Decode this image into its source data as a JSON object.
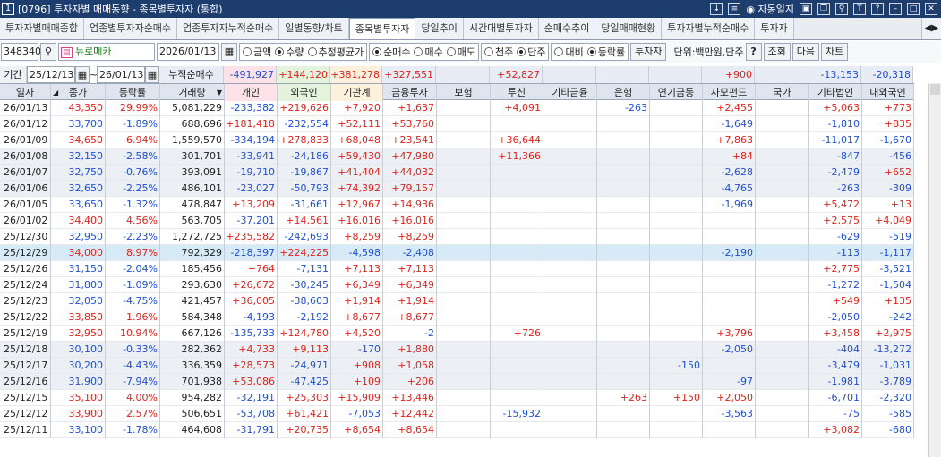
{
  "title": {
    "num": "1",
    "text": "[0796] 투자자별 매매동향 - 종목별투자자 (통합)",
    "autolog": "자동일지"
  },
  "tabs": [
    "투자자별매매종합",
    "업종별투자자순매수",
    "업종투자자누적순매수",
    "일별동향/차트",
    "종목별투자자",
    "당일추이",
    "시간대별투자자",
    "순매수추이",
    "당일매매현황",
    "투자자별누적순매수",
    "투자자"
  ],
  "active_tab": 4,
  "controls": {
    "code": "348340",
    "stock_name": "뉴로메카",
    "date": "2026/01/13",
    "amount_label": "금액",
    "qty_label": "수량",
    "est_label": "추정평균가",
    "net_label": "순매수",
    "buy_label": "매수",
    "sell_label": "매도",
    "thousand_label": "천주",
    "share_label": "단주",
    "compare_label": "대비",
    "rate_label": "등락률",
    "investor_btn": "투자자",
    "unit_label": "단위:백만원,단주",
    "help": "?",
    "search_btn": "조회",
    "next_btn": "다음",
    "chart_btn": "차트"
  },
  "summary": {
    "period_label": "기간",
    "from": "25/12/13",
    "to": "26/01/13",
    "cum_label": "누적순매수",
    "values": [
      "-491,927",
      "+144,120",
      "+381,278",
      "+327,551",
      "",
      "+52,827",
      "",
      "",
      "",
      "+900",
      "",
      "-13,153",
      "-20,318"
    ]
  },
  "headers": [
    "일자",
    "종가",
    "등락률",
    "거래량",
    "개인",
    "외국인",
    "기관계",
    "금융투자",
    "보험",
    "투신",
    "기타금융",
    "은행",
    "연기금등",
    "사모펀드",
    "국가",
    "기타법인",
    "내외국인"
  ],
  "rows": [
    [
      "26/01/13",
      "43,350",
      "29.99%",
      "5,081,229",
      "-233,382",
      "+219,626",
      "+7,920",
      "+1,637",
      "",
      "+4,091",
      "",
      "-263",
      "",
      "+2,455",
      "",
      "+5,063",
      "+773"
    ],
    [
      "26/01/12",
      "33,700",
      "-1.89%",
      "688,696",
      "+181,418",
      "-232,554",
      "+52,111",
      "+53,760",
      "",
      "",
      "",
      "",
      "",
      "-1,649",
      "",
      "-1,810",
      "+835"
    ],
    [
      "26/01/09",
      "34,650",
      "6.94%",
      "1,559,570",
      "-334,194",
      "+278,833",
      "+68,048",
      "+23,541",
      "",
      "+36,644",
      "",
      "",
      "",
      "+7,863",
      "",
      "-11,017",
      "-1,670"
    ],
    [
      "26/01/08",
      "32,150",
      "-2.58%",
      "301,701",
      "-33,941",
      "-24,186",
      "+59,430",
      "+47,980",
      "",
      "+11,366",
      "",
      "",
      "",
      "+84",
      "",
      "-847",
      "-456"
    ],
    [
      "26/01/07",
      "32,750",
      "-0.76%",
      "393,091",
      "-19,710",
      "-19,867",
      "+41,404",
      "+44,032",
      "",
      "",
      "",
      "",
      "",
      "-2,628",
      "",
      "-2,479",
      "+652"
    ],
    [
      "26/01/06",
      "32,650",
      "-2.25%",
      "486,101",
      "-23,027",
      "-50,793",
      "+74,392",
      "+79,157",
      "",
      "",
      "",
      "",
      "",
      "-4,765",
      "",
      "-263",
      "-309"
    ],
    [
      "26/01/05",
      "33,650",
      "-1.32%",
      "478,847",
      "+13,209",
      "-31,661",
      "+12,967",
      "+14,936",
      "",
      "",
      "",
      "",
      "",
      "-1,969",
      "",
      "+5,472",
      "+13"
    ],
    [
      "26/01/02",
      "34,400",
      "4.56%",
      "563,705",
      "-37,201",
      "+14,561",
      "+16,016",
      "+16,016",
      "",
      "",
      "",
      "",
      "",
      "",
      "",
      "+2,575",
      "+4,049"
    ],
    [
      "25/12/30",
      "32,950",
      "-2.23%",
      "1,272,725",
      "+235,582",
      "-242,693",
      "+8,259",
      "+8,259",
      "",
      "",
      "",
      "",
      "",
      "",
      "",
      "-629",
      "-519"
    ],
    [
      "25/12/29",
      "34,000",
      "8.97%",
      "792,329",
      "-218,397",
      "+224,225",
      "-4,598",
      "-2,408",
      "",
      "",
      "",
      "",
      "",
      "-2,190",
      "",
      "-113",
      "-1,117"
    ],
    [
      "25/12/26",
      "31,150",
      "-2.04%",
      "185,456",
      "+764",
      "-7,131",
      "+7,113",
      "+7,113",
      "",
      "",
      "",
      "",
      "",
      "",
      "",
      "+2,775",
      "-3,521"
    ],
    [
      "25/12/24",
      "31,800",
      "-1.09%",
      "293,630",
      "+26,672",
      "-30,245",
      "+6,349",
      "+6,349",
      "",
      "",
      "",
      "",
      "",
      "",
      "",
      "-1,272",
      "-1,504"
    ],
    [
      "25/12/23",
      "32,050",
      "-4.75%",
      "421,457",
      "+36,005",
      "-38,603",
      "+1,914",
      "+1,914",
      "",
      "",
      "",
      "",
      "",
      "",
      "",
      "+549",
      "+135"
    ],
    [
      "25/12/22",
      "33,850",
      "1.96%",
      "584,348",
      "-4,193",
      "-2,192",
      "+8,677",
      "+8,677",
      "",
      "",
      "",
      "",
      "",
      "",
      "",
      "-2,050",
      "-242"
    ],
    [
      "25/12/19",
      "32,950",
      "10.94%",
      "667,126",
      "-135,733",
      "+124,780",
      "+4,520",
      "-2",
      "",
      "+726",
      "",
      "",
      "",
      "+3,796",
      "",
      "+3,458",
      "+2,975"
    ],
    [
      "25/12/18",
      "30,100",
      "-0.33%",
      "282,362",
      "+4,733",
      "+9,113",
      "-170",
      "+1,880",
      "",
      "",
      "",
      "",
      "",
      "-2,050",
      "",
      "-404",
      "-13,272"
    ],
    [
      "25/12/17",
      "30,200",
      "-4.43%",
      "336,359",
      "+28,573",
      "-24,971",
      "+908",
      "+1,058",
      "",
      "",
      "",
      "",
      "-150",
      "",
      "",
      "-3,479",
      "-1,031"
    ],
    [
      "25/12/16",
      "31,900",
      "-7.94%",
      "701,938",
      "+53,086",
      "-47,425",
      "+109",
      "+206",
      "",
      "",
      "",
      "",
      "",
      "-97",
      "",
      "-1,981",
      "-3,789"
    ],
    [
      "25/12/15",
      "35,100",
      "4.00%",
      "954,282",
      "-32,191",
      "+25,303",
      "+15,909",
      "+13,446",
      "",
      "",
      "",
      "+263",
      "+150",
      "+2,050",
      "",
      "-6,701",
      "-2,320"
    ],
    [
      "25/12/12",
      "33,900",
      "2.57%",
      "506,651",
      "-53,708",
      "+61,421",
      "-7,053",
      "+12,442",
      "",
      "-15,932",
      "",
      "",
      "",
      "-3,563",
      "",
      "-75",
      "-585"
    ],
    [
      "25/12/11",
      "33,100",
      "-1.78%",
      "464,608",
      "-31,791",
      "+20,735",
      "+8,654",
      "+8,654",
      "",
      "",
      "",
      "",
      "",
      "",
      "",
      "+3,082",
      "-680"
    ]
  ],
  "gray_rows": [
    3,
    4,
    5,
    15,
    16,
    17
  ],
  "selected_row": 9,
  "colors": {
    "red": "#e0221b",
    "blue": "#1f4fd4",
    "titlebar": "#1c3d6e"
  }
}
